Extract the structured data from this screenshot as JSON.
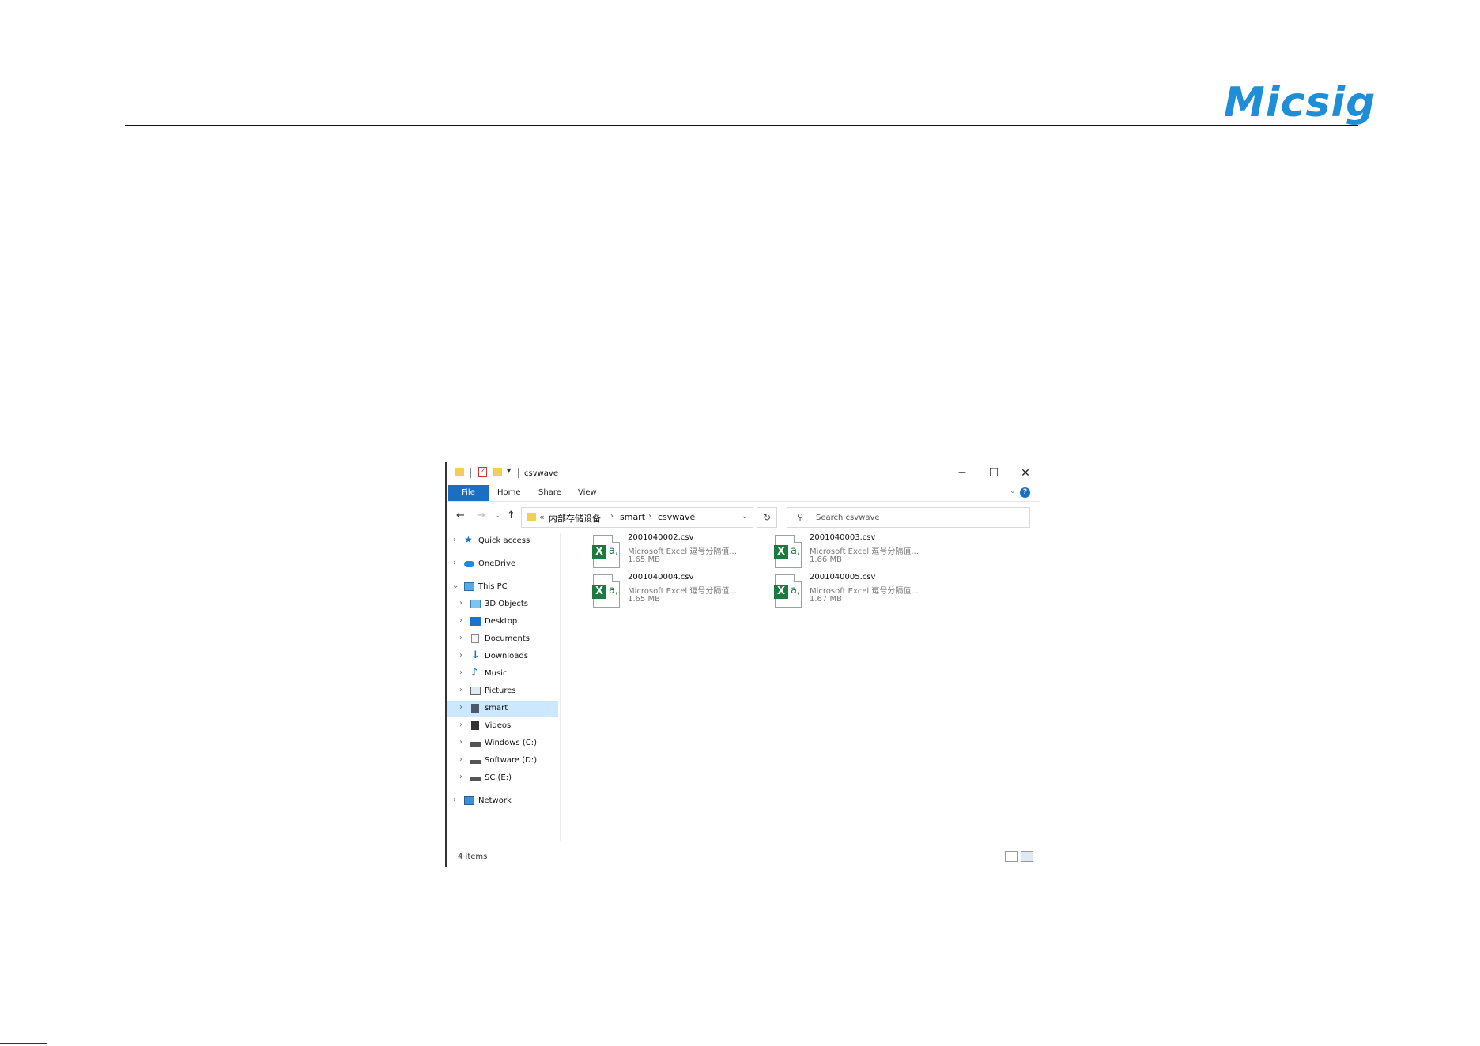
{
  "brand": "Micsig",
  "window": {
    "title": "csvwave",
    "controls": {
      "minimize": "─",
      "maximize": "☐",
      "close": "✕"
    }
  },
  "ribbon": {
    "tabs": [
      "File",
      "Home",
      "Share",
      "View"
    ],
    "help": "?"
  },
  "address": {
    "prefix": "«",
    "crumbs": [
      "内部存储设备",
      "smart",
      "csvwave"
    ],
    "separator": "›"
  },
  "search": {
    "placeholder": "Search csvwave"
  },
  "nav": {
    "items": [
      {
        "label": "Quick access",
        "icon": "star-icon"
      },
      {
        "label": "OneDrive",
        "icon": "cloud-icon"
      },
      {
        "label": "This PC",
        "icon": "computer-icon"
      },
      {
        "label": "3D Objects",
        "icon": "cube-icon"
      },
      {
        "label": "Desktop",
        "icon": "desktop-icon"
      },
      {
        "label": "Documents",
        "icon": "document-icon"
      },
      {
        "label": "Downloads",
        "icon": "download-icon"
      },
      {
        "label": "Music",
        "icon": "music-icon"
      },
      {
        "label": "Pictures",
        "icon": "picture-icon"
      },
      {
        "label": "smart",
        "icon": "device-icon",
        "selected": true
      },
      {
        "label": "Videos",
        "icon": "video-icon"
      },
      {
        "label": "Windows (C:)",
        "icon": "drive-icon"
      },
      {
        "label": "Software (D:)",
        "icon": "drive-icon"
      },
      {
        "label": "SC (E:)",
        "icon": "drive-icon"
      },
      {
        "label": "Network",
        "icon": "network-icon"
      }
    ]
  },
  "files": [
    {
      "name": "2001040002.csv",
      "type": "Microsoft Excel 逗号分隔值...",
      "size": "1.65 MB"
    },
    {
      "name": "2001040003.csv",
      "type": "Microsoft Excel 逗号分隔值...",
      "size": "1.66 MB"
    },
    {
      "name": "2001040004.csv",
      "type": "Microsoft Excel 逗号分隔值...",
      "size": "1.65 MB"
    },
    {
      "name": "2001040005.csv",
      "type": "Microsoft Excel 逗号分隔值...",
      "size": "1.67 MB"
    }
  ],
  "status": {
    "count": "4 items"
  },
  "colors": {
    "accent": "#1a6fc2",
    "brand": "#1e8fd6",
    "excel": "#1d7a3f",
    "selection": "#cce8ff"
  }
}
